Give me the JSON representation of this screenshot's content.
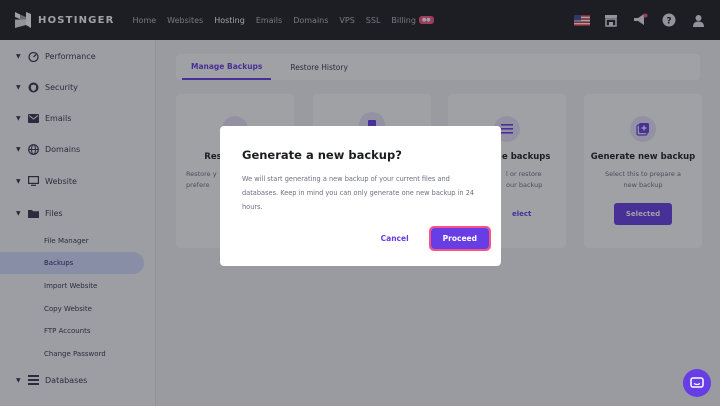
{
  "brand": {
    "name": "HOSTINGER"
  },
  "nav": [
    {
      "label": "Home"
    },
    {
      "label": "Websites"
    },
    {
      "label": "Hosting"
    },
    {
      "label": "Emails"
    },
    {
      "label": "Domains"
    },
    {
      "label": "VPS"
    },
    {
      "label": "SSL"
    },
    {
      "label": "Billing"
    }
  ],
  "nav_active": "Hosting",
  "topbar_icons": [
    "us-flag-icon",
    "store-icon",
    "megaphone-icon",
    "help-icon",
    "user-icon"
  ],
  "sidebar": {
    "items": [
      {
        "label": "Performance",
        "icon": "gauge-icon"
      },
      {
        "label": "Security",
        "icon": "shield-icon"
      },
      {
        "label": "Emails",
        "icon": "mail-icon"
      },
      {
        "label": "Domains",
        "icon": "globe-icon"
      },
      {
        "label": "Website",
        "icon": "monitor-icon"
      },
      {
        "label": "Files",
        "icon": "folder-icon"
      }
    ],
    "sub_items": [
      {
        "label": "File Manager"
      },
      {
        "label": "Backups"
      },
      {
        "label": "Import Website"
      },
      {
        "label": "Copy Website"
      },
      {
        "label": "FTP Accounts"
      },
      {
        "label": "Change Password"
      }
    ],
    "active_sub": "Backups",
    "last_item": {
      "label": "Databases",
      "icon": "database-icon"
    }
  },
  "tabs": [
    {
      "label": "Manage Backups"
    },
    {
      "label": "Restore History"
    }
  ],
  "cards": [
    {
      "title": "Rest",
      "desc": "Restore y\nprefere"
    },
    {
      "title": "",
      "desc": ""
    },
    {
      "title": "e backups",
      "desc": "l or restore\nour backup",
      "button": "elect"
    },
    {
      "title": "Generate new backup",
      "desc": "Select this to prepare a\nnew backup",
      "button": "Selected"
    }
  ],
  "modal": {
    "title": "Generate a new backup?",
    "body": "We will start generating a new backup of your current files and databases. Keep in mind you can only generate one new backup in 24 hours.",
    "cancel": "Cancel",
    "proceed": "Proceed"
  },
  "colors": {
    "brand_purple": "#673de6",
    "topbar_bg": "#1d1e20",
    "highlight": "#fc5185",
    "active_sub_bg": "#d5dfff"
  }
}
